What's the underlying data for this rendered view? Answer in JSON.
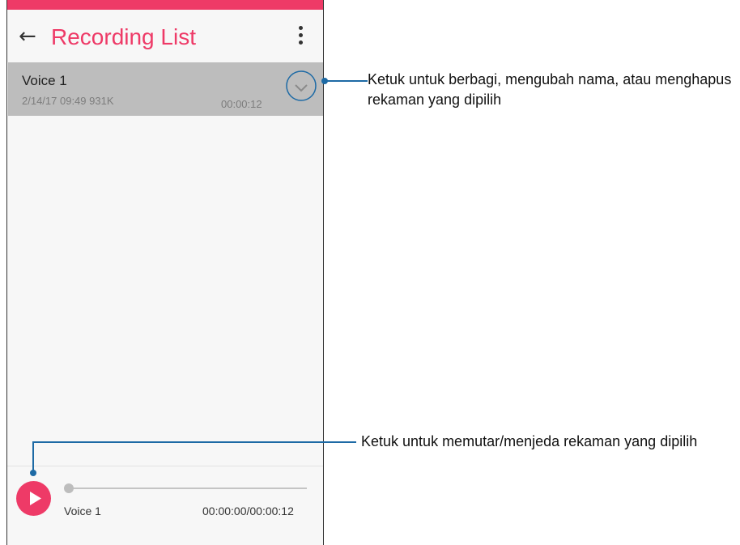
{
  "app": {
    "title": "Recording List"
  },
  "icons": {
    "back": "←",
    "more": "more-vert-icon",
    "expand": "chevron-down-icon",
    "play": "play-icon"
  },
  "colors": {
    "accent": "#ee3a67",
    "selected_row": "#bdbdbd",
    "callout_line": "#1d6aa5"
  },
  "recordings": [
    {
      "name": "Voice 1",
      "meta": "2/14/17 09:49  931K",
      "duration": "00:00:12"
    }
  ],
  "player": {
    "name": "Voice 1",
    "time": "00:00:00/00:00:12",
    "progress": 0
  },
  "callouts": {
    "expand": "Ketuk untuk berbagi, mengubah nama, atau menghapus rekaman yang dipilih",
    "play": "Ketuk untuk memutar/menjeda rekaman yang dipilih"
  }
}
